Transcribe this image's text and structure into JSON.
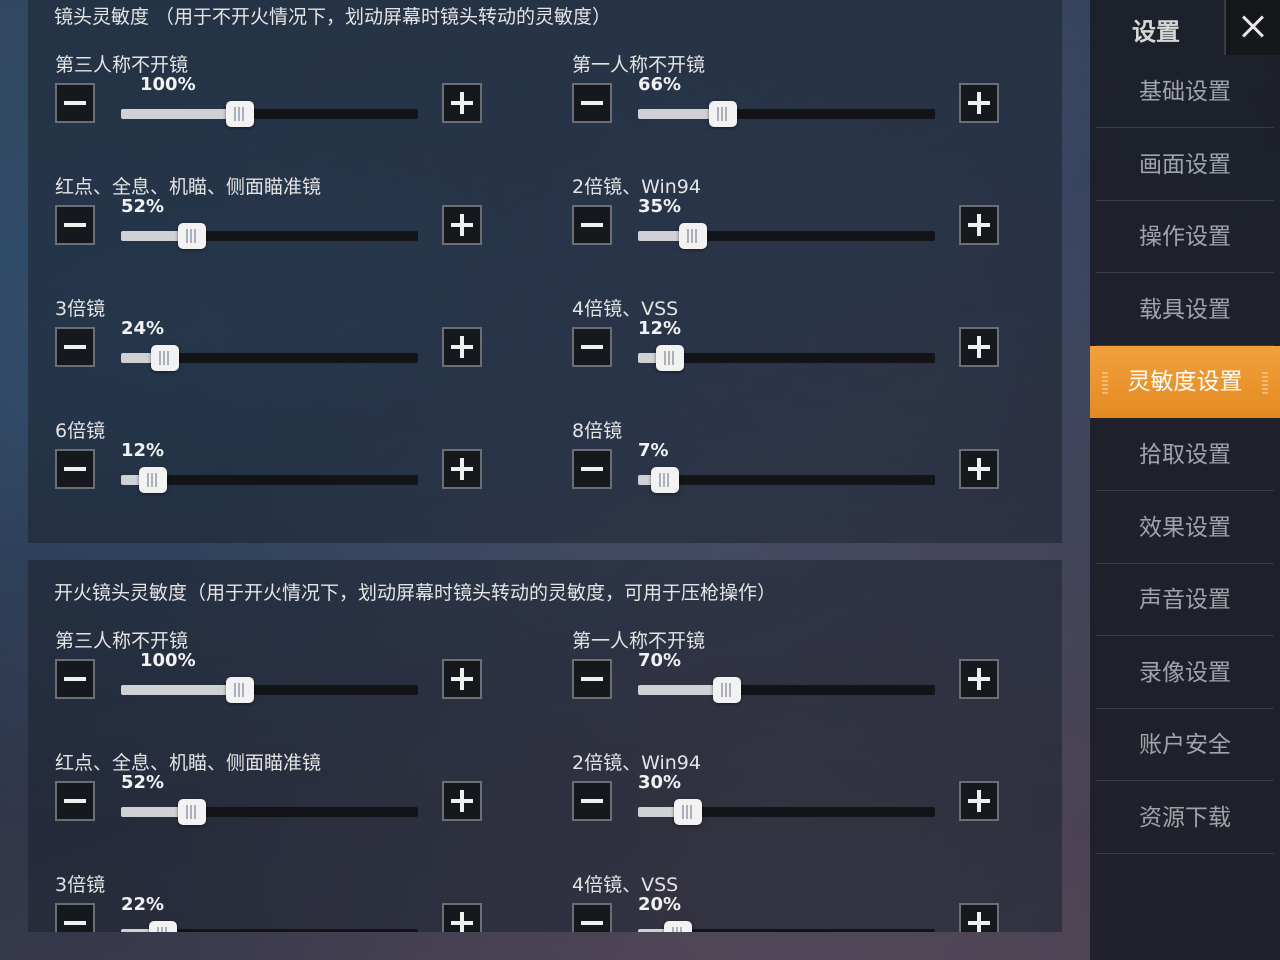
{
  "camera_sensitivity": {
    "title": "镜头灵敏度 （用于不开火情况下，划动屏幕时镜头转动的灵敏度）",
    "sliders": [
      {
        "label": "第三人称不开镜",
        "value": 100,
        "text": "100%"
      },
      {
        "label": "第一人称不开镜",
        "value": 66,
        "text": "66%"
      },
      {
        "label": "红点、全息、机瞄、侧面瞄准镜",
        "value": 52,
        "text": "52%"
      },
      {
        "label": "2倍镜、Win94",
        "value": 35,
        "text": "35%"
      },
      {
        "label": "3倍镜",
        "value": 24,
        "text": "24%"
      },
      {
        "label": "4倍镜、VSS",
        "value": 12,
        "text": "12%"
      },
      {
        "label": "6倍镜",
        "value": 12,
        "text": "12%"
      },
      {
        "label": "8倍镜",
        "value": 7,
        "text": "7%"
      }
    ]
  },
  "firing_sensitivity": {
    "title": "开火镜头灵敏度（用于开火情况下，划动屏幕时镜头转动的灵敏度，可用于压枪操作）",
    "sliders": [
      {
        "label": "第三人称不开镜",
        "value": 100,
        "text": "100%"
      },
      {
        "label": "第一人称不开镜",
        "value": 70,
        "text": "70%"
      },
      {
        "label": "红点、全息、机瞄、侧面瞄准镜",
        "value": 52,
        "text": "52%"
      },
      {
        "label": "2倍镜、Win94",
        "value": 30,
        "text": "30%"
      },
      {
        "label": "3倍镜",
        "value": 22,
        "text": "22%"
      },
      {
        "label": "4倍镜、VSS",
        "value": 20,
        "text": "20%"
      }
    ]
  },
  "slider_range": {
    "min": 0,
    "max": 300
  },
  "sidebar": {
    "title": "设置",
    "items": [
      {
        "label": "基础设置",
        "active": false
      },
      {
        "label": "画面设置",
        "active": false
      },
      {
        "label": "操作设置",
        "active": false
      },
      {
        "label": "载具设置",
        "active": false
      },
      {
        "label": "灵敏度设置",
        "active": true
      },
      {
        "label": "拾取设置",
        "active": false
      },
      {
        "label": "效果设置",
        "active": false
      },
      {
        "label": "声音设置",
        "active": false
      },
      {
        "label": "录像设置",
        "active": false
      },
      {
        "label": "账户安全",
        "active": false
      },
      {
        "label": "资源下载",
        "active": false
      }
    ]
  },
  "colors": {
    "accent": "#ea9030",
    "track_fill": "#cfd1d4",
    "track": "#121418"
  },
  "icons": {
    "decrease": "minus-icon",
    "increase": "plus-icon",
    "close": "close-icon"
  }
}
